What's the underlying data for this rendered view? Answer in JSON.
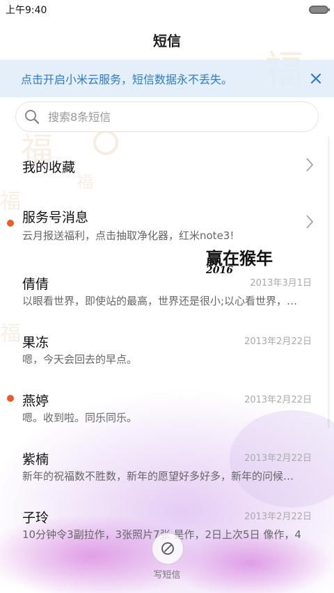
{
  "status_bar": {
    "time": "上午9:40"
  },
  "header": {
    "title": "短信"
  },
  "banner": {
    "text": "点击开启小米云服务，短信数据永不丢失。"
  },
  "search": {
    "placeholder": "搜索8条短信"
  },
  "decor": {
    "calligraphy": "赢在猴年",
    "year": "2016"
  },
  "list": {
    "favorites": {
      "label": "我的收藏"
    },
    "service": {
      "name": "服务号消息",
      "preview": "云月报送福利，点击抽取净化器，红米note3!",
      "unread": true
    },
    "conversations": [
      {
        "name": "倩倩",
        "date": "2013年3月1日",
        "preview": "以眼看世界，即使站的最高，世界还是很小;以心看世界，…",
        "unread": false
      },
      {
        "name": "果冻",
        "date": "2013年2月22日",
        "preview": "嗯，今天会回去的早点。",
        "unread": false
      },
      {
        "name": "燕婷",
        "date": "2013年2月22日",
        "preview": "嗯。收到啦。同乐同乐。",
        "unread": true
      },
      {
        "name": "紫楠",
        "date": "2013年2月22日",
        "preview": "新年的祝福数不胜数，新年的愿望好多好多，新年的问候…",
        "unread": false
      },
      {
        "name": "子玲",
        "date": "2013年2月22日",
        "preview": "10分钟令3副拉作，3张照片7张 是作，2日上次5日 像作，4",
        "unread": false
      }
    ]
  },
  "compose": {
    "label": "写短信"
  },
  "colors": {
    "accent": "#2b7ad6",
    "unread_dot": "#f05a28",
    "banner_bg": "#e1edf9"
  }
}
